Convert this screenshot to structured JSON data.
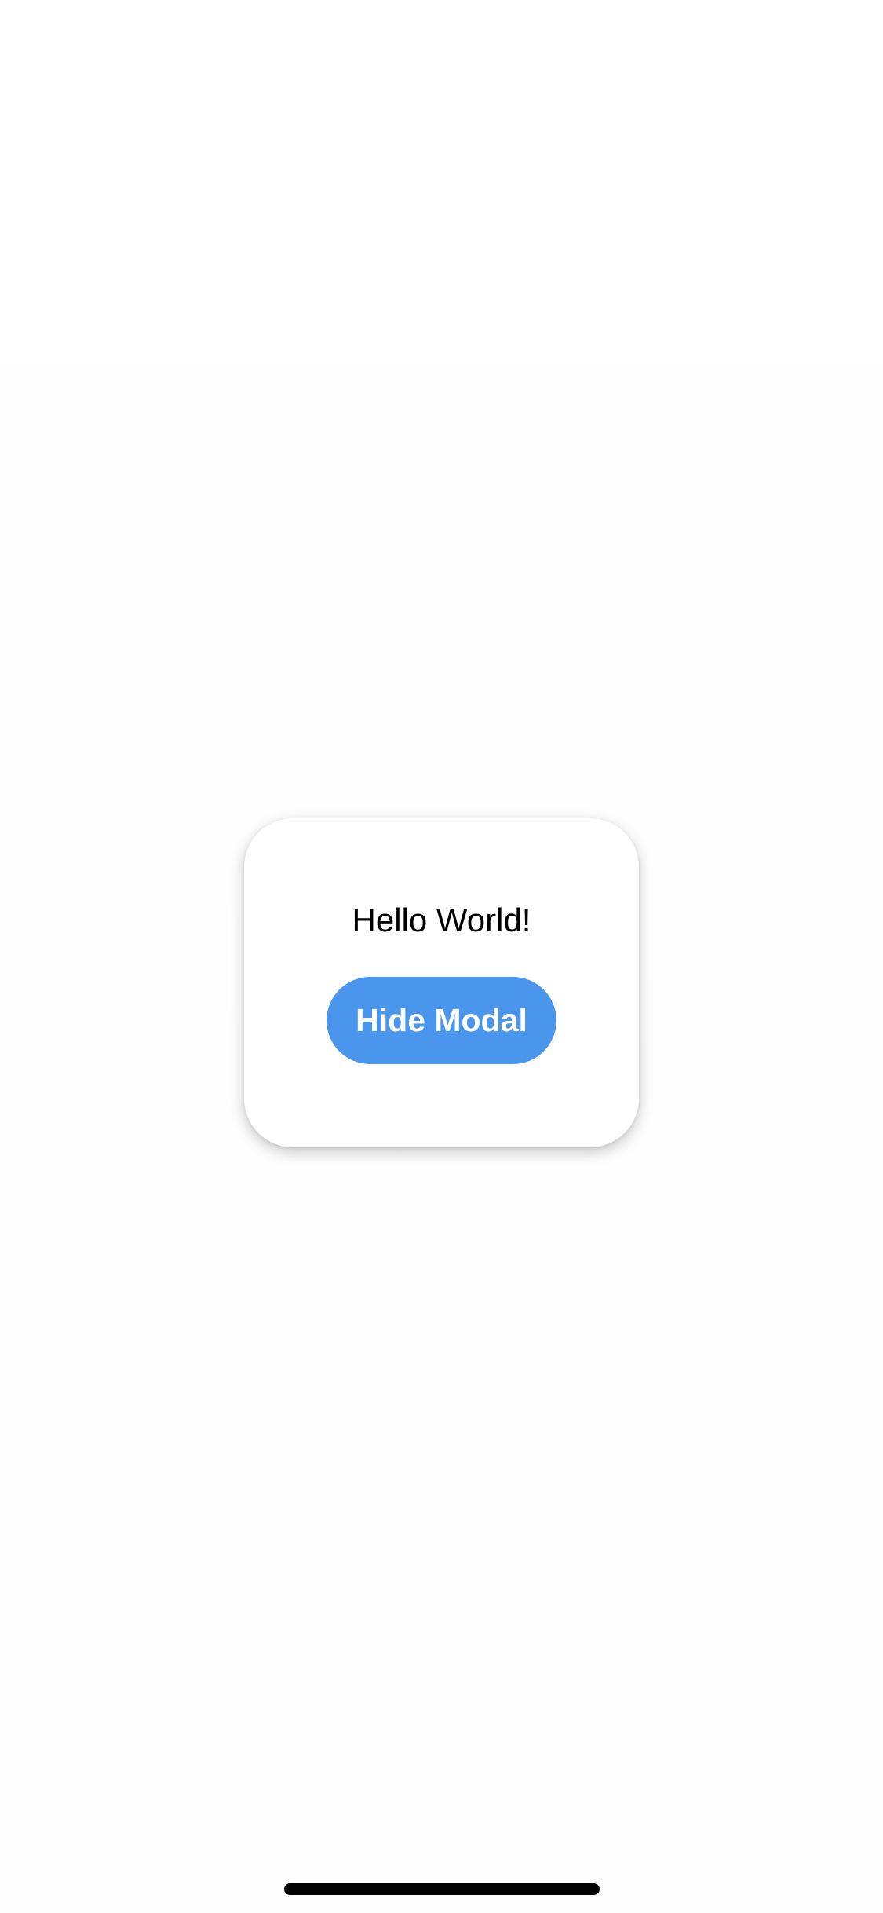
{
  "modal": {
    "message": "Hello World!",
    "button_label": "Hide Modal"
  },
  "colors": {
    "button_background": "#4a96ec",
    "button_text": "#ffffff",
    "modal_background": "#ffffff",
    "message_text": "#000000",
    "home_indicator": "#000000"
  }
}
